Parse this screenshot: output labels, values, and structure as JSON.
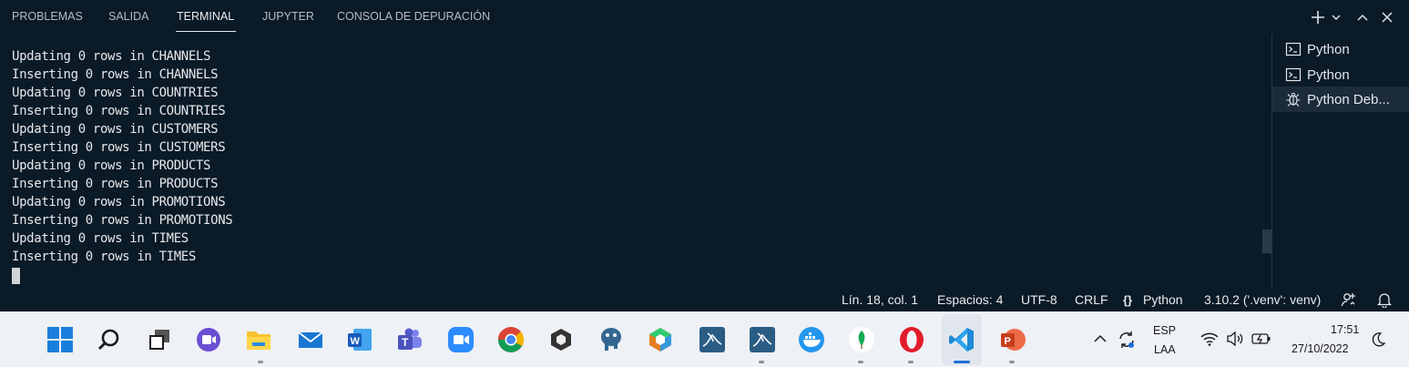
{
  "panel": {
    "tabs": [
      {
        "label": "PROBLEMAS"
      },
      {
        "label": "SALIDA"
      },
      {
        "label": "TERMINAL"
      },
      {
        "label": "JUPYTER"
      },
      {
        "label": "CONSOLA DE DEPURACIÓN"
      }
    ],
    "active_tab": "TERMINAL",
    "actions": [
      "add-icon",
      "chevron-down-icon",
      "chevron-up-icon",
      "close-icon"
    ]
  },
  "terminal": {
    "lines": [
      "Updating 0 rows in CHANNELS",
      "Inserting 0 rows in CHANNELS",
      "Updating 0 rows in COUNTRIES",
      "Inserting 0 rows in COUNTRIES",
      "Updating 0 rows in CUSTOMERS",
      "Inserting 0 rows in CUSTOMERS",
      "Updating 0 rows in PRODUCTS",
      "Inserting 0 rows in PRODUCTS",
      "Updating 0 rows in PROMOTIONS",
      "Inserting 0 rows in PROMOTIONS",
      "Updating 0 rows in TIMES",
      "Inserting 0 rows in TIMES"
    ]
  },
  "terminal_list": {
    "items": [
      {
        "label": "Python",
        "icon": "terminal-icon"
      },
      {
        "label": "Python",
        "icon": "terminal-icon"
      },
      {
        "label": "Python Deb...",
        "icon": "debug-icon",
        "selected": true
      }
    ]
  },
  "statusbar": {
    "position": "Lín. 18, col. 1",
    "spaces": "Espacios: 4",
    "encoding": "UTF-8",
    "eol": "CRLF",
    "language": "Python",
    "interpreter": "3.10.2 ('.venv': venv)"
  },
  "taskbar": {
    "apps": [
      "windows-start-icon",
      "search-icon",
      "task-view-icon",
      "chat-icon",
      "file-explorer-icon",
      "mail-icon",
      "word-icon",
      "teams-icon",
      "zoom-icon",
      "chrome-icon",
      "unity-icon",
      "postgresql-icon",
      "app-cube-icon",
      "mysql-workbench-icon",
      "mysql-workbench-icon",
      "docker-icon",
      "mongodb-icon",
      "opera-icon",
      "vscode-icon",
      "powerpoint-icon"
    ],
    "lang_top": "ESP",
    "lang_bottom": "LAA",
    "time": "17:51",
    "date": "27/10/2022"
  },
  "colors": {
    "background": "#0a1a26",
    "accent": "#1d6fd8"
  }
}
